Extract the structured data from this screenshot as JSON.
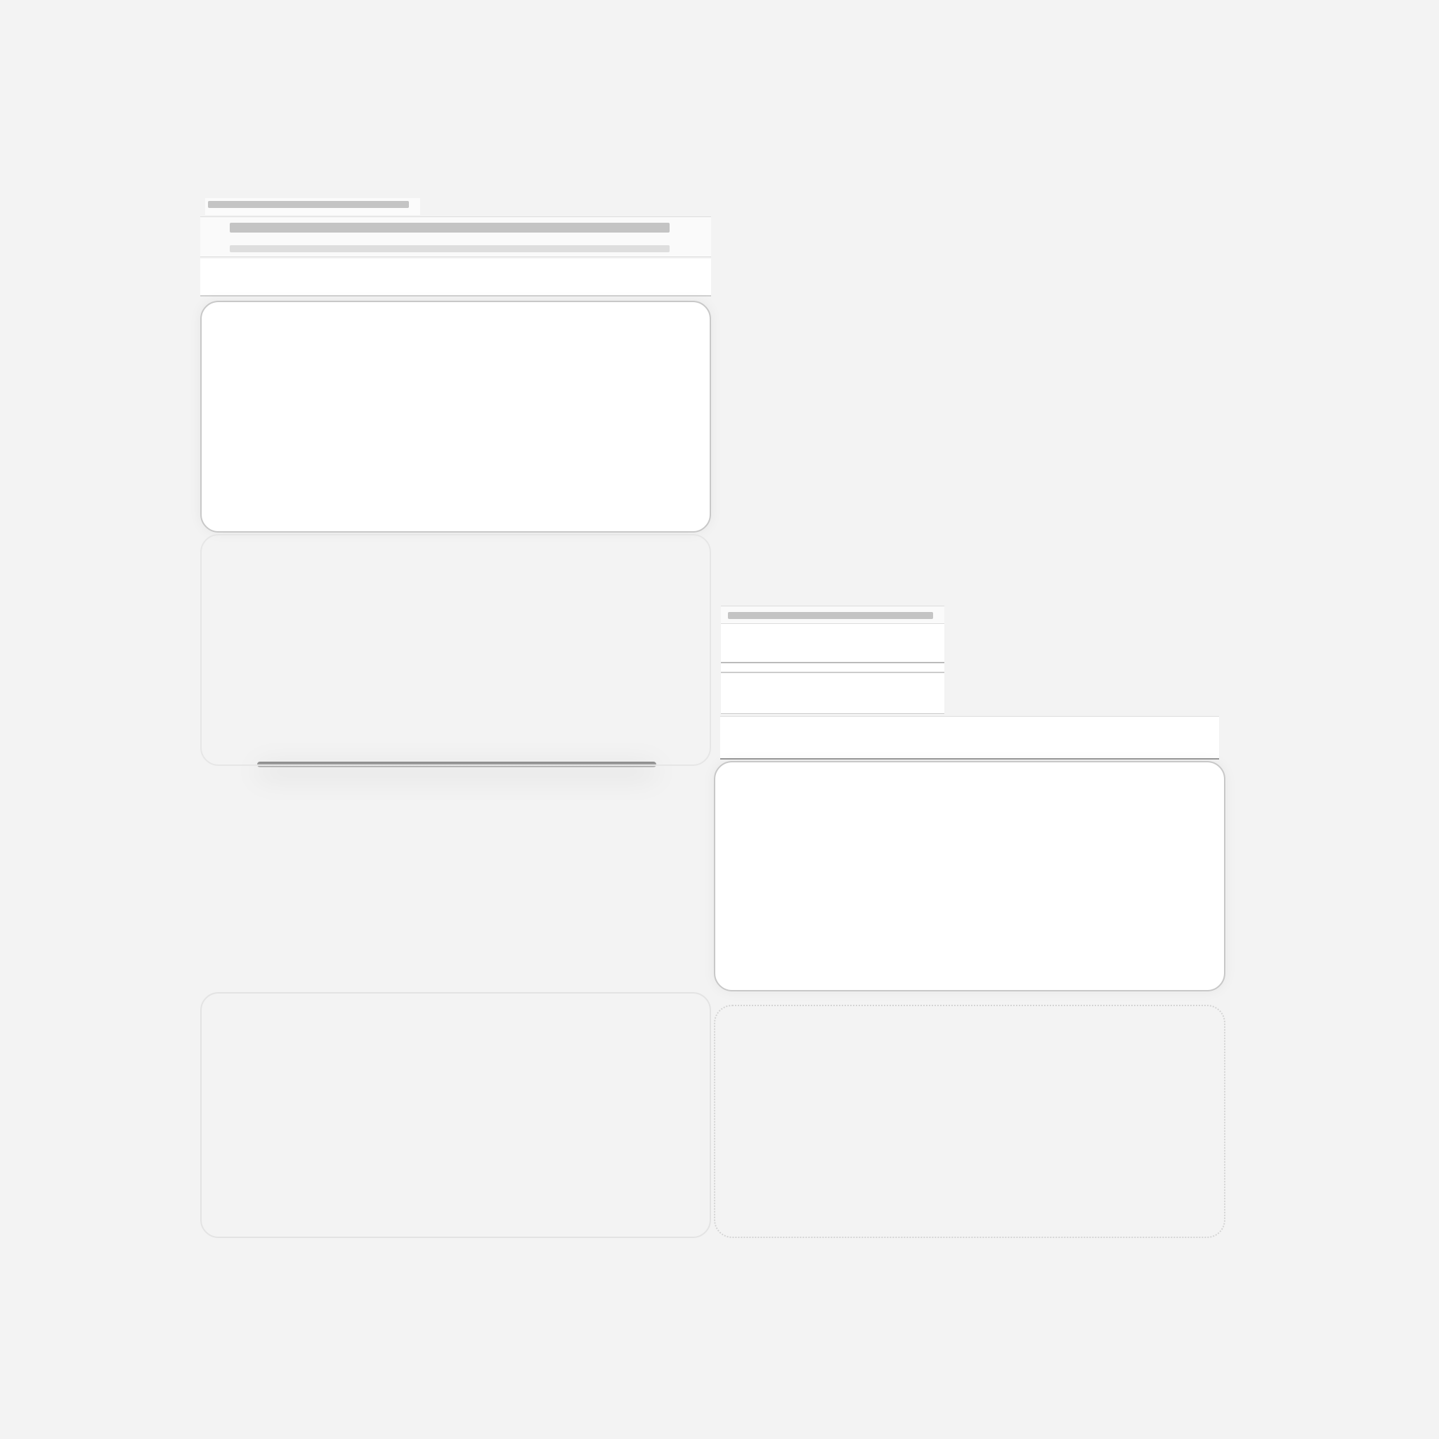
{
  "colors": {
    "background": "#f3f3f3",
    "card": "#ffffff",
    "border": "#c8c8c8",
    "placeholder_bar": "#c4c4c4"
  },
  "left_panel": {
    "title": "",
    "subtitle": ""
  },
  "right_panel": {
    "title": "",
    "subtitle": ""
  }
}
